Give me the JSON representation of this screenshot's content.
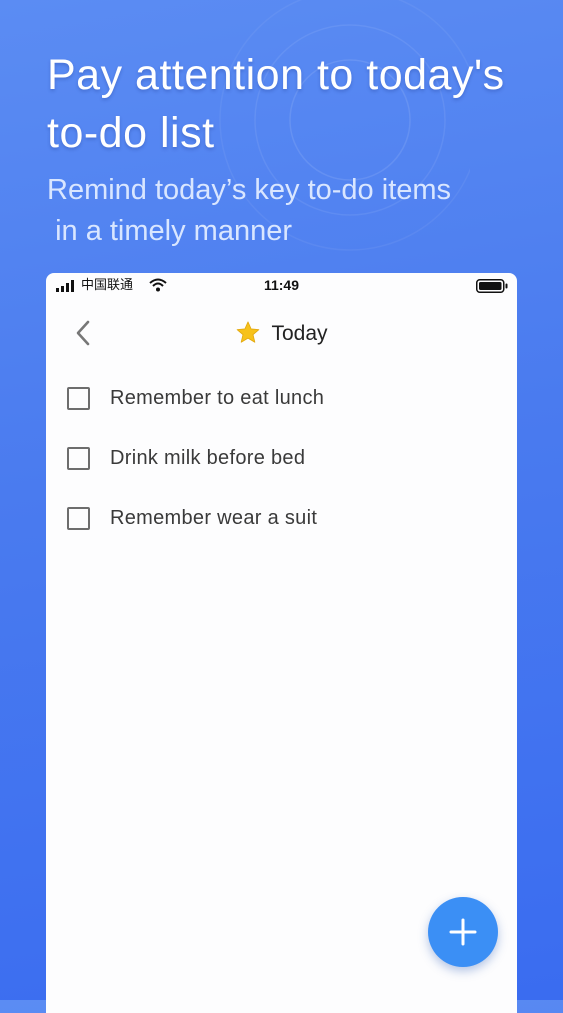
{
  "promo": {
    "headline": "Pay attention to today's to-do list",
    "subline": "Remind today’s key to-do items\n in a timely manner"
  },
  "status_bar": {
    "carrier": "中国联通",
    "time": "11:49",
    "icons": [
      "signal-icon",
      "wifi-icon",
      "battery-icon"
    ]
  },
  "nav": {
    "back_icon": "chevron-left-icon",
    "title_icon": "star-icon",
    "title": "Today"
  },
  "todos": [
    {
      "label": "Remember to eat lunch",
      "checked": false
    },
    {
      "label": "Drink milk before bed",
      "checked": false
    },
    {
      "label": "Remember wear a suit",
      "checked": false
    }
  ],
  "fab": {
    "icon": "plus-icon"
  },
  "colors": {
    "background": "#4a7bef",
    "fab": "#3b8ff5",
    "star": "#f7c21b",
    "card": "#fdfdfe"
  }
}
